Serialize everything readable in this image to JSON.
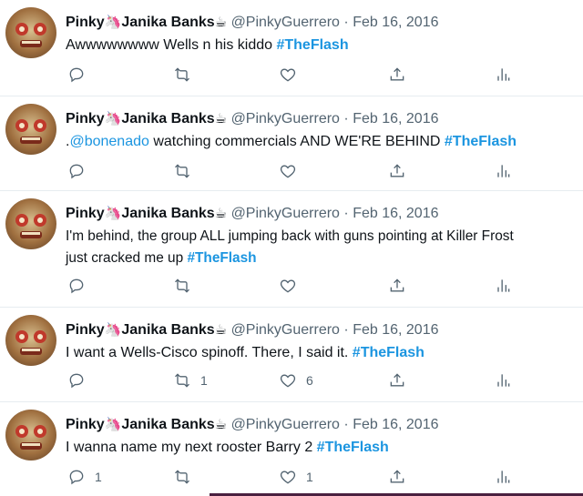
{
  "tweets": [
    {
      "name": "Pinky",
      "name2": "Janika Banks",
      "emoji1": "🦄",
      "emoji2": "☕",
      "handle": "@PinkyGuerrero",
      "dot": "·",
      "date": "Feb 16, 2016",
      "text_before": "Awwwwwwww Wells n his kiddo ",
      "mention": "",
      "text_after": "",
      "hashtag": "#TheFlash",
      "text_line2": "",
      "hashtag2": "",
      "replies": "",
      "retweets": "",
      "likes": ""
    },
    {
      "name": "Pinky",
      "name2": "Janika Banks",
      "emoji1": "🦄",
      "emoji2": "☕",
      "handle": "@PinkyGuerrero",
      "dot": "·",
      "date": "Feb 16, 2016",
      "text_before": ".",
      "mention": "@bonenado",
      "text_after": " watching commercials AND WE'RE BEHIND ",
      "hashtag": "#TheFlash",
      "text_line2": "",
      "hashtag2": "",
      "replies": "",
      "retweets": "",
      "likes": ""
    },
    {
      "name": "Pinky",
      "name2": "Janika Banks",
      "emoji1": "🦄",
      "emoji2": "☕",
      "handle": "@PinkyGuerrero",
      "dot": "·",
      "date": "Feb 16, 2016",
      "text_before": "I'm behind, the group ALL jumping back with guns pointing at Killer Frost",
      "mention": "",
      "text_after": "",
      "hashtag": "",
      "text_line2": "just cracked me up ",
      "hashtag2": "#TheFlash",
      "replies": "",
      "retweets": "",
      "likes": ""
    },
    {
      "name": "Pinky",
      "name2": "Janika Banks",
      "emoji1": "🦄",
      "emoji2": "☕",
      "handle": "@PinkyGuerrero",
      "dot": "·",
      "date": "Feb 16, 2016",
      "text_before": "I want a Wells-Cisco spinoff. There, I said it. ",
      "mention": "",
      "text_after": "",
      "hashtag": "#TheFlash",
      "text_line2": "",
      "hashtag2": "",
      "replies": "",
      "retweets": "1",
      "likes": "6"
    },
    {
      "name": "Pinky",
      "name2": "Janika Banks",
      "emoji1": "🦄",
      "emoji2": "☕",
      "handle": "@PinkyGuerrero",
      "dot": "·",
      "date": "Feb 16, 2016",
      "text_before": "I wanna name my next rooster Barry 2 ",
      "mention": "",
      "text_after": "",
      "hashtag": "#TheFlash",
      "text_line2": "",
      "hashtag2": "",
      "replies": "1",
      "retweets": "",
      "likes": "1"
    }
  ],
  "icons": {
    "reply": "reply-icon",
    "retweet": "retweet-icon",
    "like": "like-icon",
    "share": "share-icon",
    "analytics": "analytics-icon"
  },
  "colors": {
    "link": "#1b95e0",
    "muted": "#536471",
    "text": "#0f1419",
    "divider": "#e6ecf0"
  }
}
